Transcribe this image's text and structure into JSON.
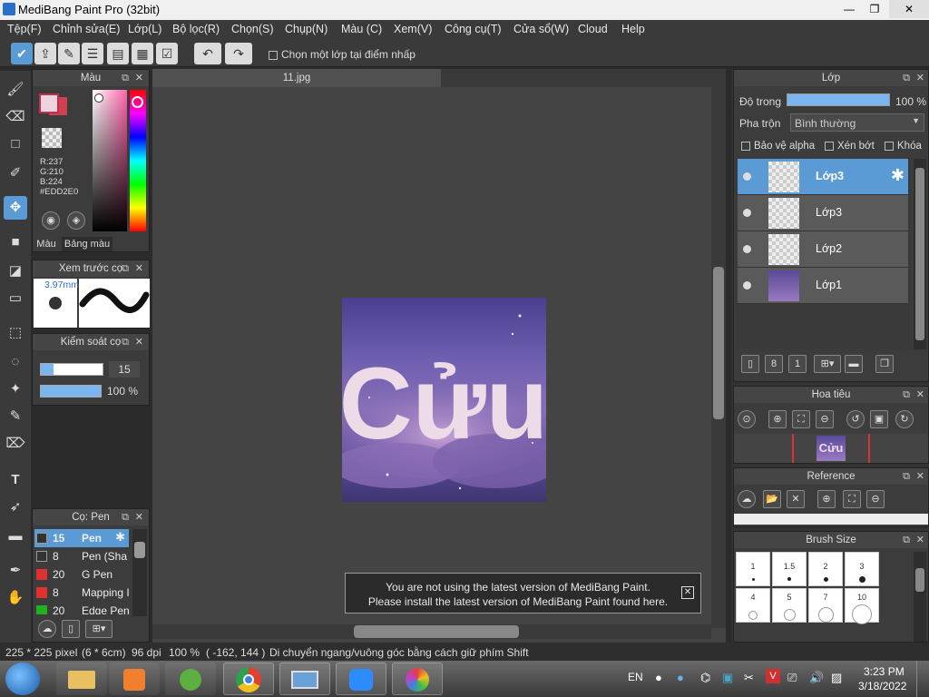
{
  "title": "MediBang Paint Pro (32bit)",
  "menu": [
    "Tệp(F)",
    "Chỉnh sửa(E)",
    "Lớp(L)",
    "Bộ lọc(R)",
    "Chọn(S)",
    "Chụp(N)",
    "Màu (C)",
    "Xem(V)",
    "Công cụ(T)",
    "Cửa sổ(W)",
    "Cloud",
    "Help"
  ],
  "toolbar": {
    "select_layer_label": "Chọn một lớp tại điểm nhấp"
  },
  "tab": {
    "name": "11.jpg"
  },
  "color_panel": {
    "title": "Màu",
    "r": "R:237",
    "g": "G:210",
    "b": "B:224",
    "hex": "#EDD2E0",
    "tab1": "Màu",
    "tab2": "Bảng màu",
    "fg": "#EDD2E0",
    "bg": "#d04050"
  },
  "brush_preview": {
    "title": "Xem trước cọ",
    "size": "3.97mm"
  },
  "brush_control": {
    "title": "Kiểm soát cọ",
    "size_value": "15",
    "size_fraction": 0.2,
    "opacity_value": "100 %",
    "opacity_fraction": 1.0
  },
  "brush_list": {
    "title": "Cọ: Pen",
    "items": [
      {
        "size": "15",
        "name": "Pen",
        "color": "#333333",
        "selected": true
      },
      {
        "size": "8",
        "name": "Pen (Sha",
        "color": "#333333"
      },
      {
        "size": "20",
        "name": "G Pen",
        "color": "#e03030"
      },
      {
        "size": "8",
        "name": "Mapping I",
        "color": "#e03030"
      },
      {
        "size": "20",
        "name": "Edge Pen",
        "color": "#20b020"
      }
    ]
  },
  "artwork": {
    "text": "Cửu"
  },
  "notification": {
    "line1": "You are not using the latest version of MediBang Paint.",
    "line2": "Please install the latest version of MediBang Paint found here."
  },
  "layers": {
    "title": "Lớp",
    "opacity_label": "Độ trong",
    "opacity_value": "100 %",
    "blend_label": "Pha trộn",
    "blend_value": "Bình thường",
    "protect_alpha": "Bảo vệ alpha",
    "clip": "Xén bớt",
    "lock": "Khóa",
    "items": [
      {
        "name": "Lớp3",
        "selected": true
      },
      {
        "name": "Lớp3"
      },
      {
        "name": "Lớp2"
      },
      {
        "name": "Lớp1"
      }
    ]
  },
  "navigator": {
    "title": "Hoa tiêu",
    "thumb_text": "Cửu"
  },
  "reference": {
    "title": "Reference"
  },
  "brush_size": {
    "title": "Brush Size",
    "row1": [
      "1",
      "1.5",
      "2",
      "3"
    ],
    "row2": [
      "4",
      "5",
      "7",
      "10"
    ]
  },
  "status": {
    "size": "225 * 225 pixel",
    "cm": "(6 * 6cm)",
    "dpi": "96 dpi",
    "zoom": "100 %",
    "coords": "( -162, 144 )",
    "hint": "Di chuyển ngang/vuông góc bằng cách giữ phím Shift"
  },
  "taskbar": {
    "lang": "EN",
    "time": "3:23 PM",
    "date": "3/18/2022"
  }
}
